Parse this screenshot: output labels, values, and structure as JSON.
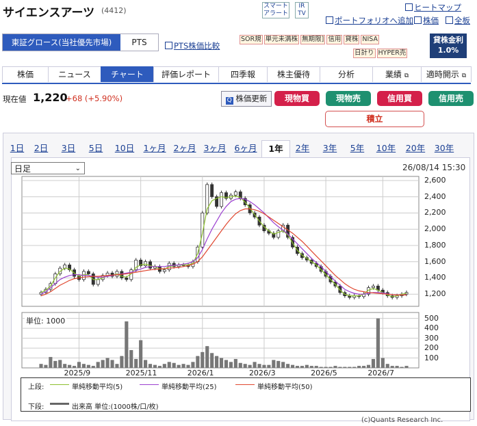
{
  "header": {
    "title": "サイエンスアーツ",
    "code": "(4412)",
    "smart_alert": "スマート\nアラート",
    "ir": "IR\nTV",
    "links": {
      "heatmap": "ヒートマップ",
      "add_portfolio": "ポートフォリオへ追加",
      "stock_price": "株価",
      "all_board": "全板",
      "pts_compare": "PTS株価比較"
    }
  },
  "market": {
    "selected": "東証グロース(当社優先市場)",
    "pts": "PTS"
  },
  "tags": [
    "SOR規",
    "単元未満株",
    "無期限]",
    "信用",
    "貸株",
    "NISA",
    "日計り",
    "HYPER売"
  ],
  "loan": {
    "label": "貸株金利",
    "rate": "1.0%"
  },
  "nav": {
    "tabs": [
      "株価",
      "ニュース",
      "チャート",
      "評価レポート",
      "四季報",
      "株主優待",
      "分析",
      "業績",
      "適時開示"
    ],
    "active": "チャート"
  },
  "quote": {
    "label": "現在値",
    "price": "1,220",
    "change": "+68 (+5.90%)"
  },
  "actions": {
    "update": "株価更新",
    "genbutsu_buy": "現物買",
    "genbutsu_sell": "現物売",
    "shinyo_buy": "信用買",
    "shinyo_sell": "信用売",
    "tsumitate": "積立"
  },
  "colors": {
    "brand": "#2e5bbd",
    "buy": "#d4204a",
    "sell": "#1e9070",
    "up": "#d03020"
  },
  "ranges": [
    "1日",
    "2日",
    "3日",
    "5日",
    "10日",
    "1ヶ月",
    "2ヶ月",
    "3ヶ月",
    "6ヶ月",
    "1年",
    "2年",
    "3年",
    "5年",
    "10年",
    "20年",
    "30年"
  ],
  "active_range": "1年",
  "chart_controls": {
    "period_select": "日足",
    "datetime": "26/08/14 15:30",
    "volume_unit": "単位: 1000"
  },
  "legend": {
    "upper_label": "上段:",
    "ma5": "単純移動平均(5)",
    "ma25": "単純移動平均(25)",
    "ma50": "単純移動平均(50)",
    "lower_label": "下段:",
    "volume": "出来高 単位:(1000株/口/枚)"
  },
  "copyright": "(c)Quants Research Inc.",
  "chart_data": {
    "type": "candlestick",
    "x_ticks": [
      "2025/9",
      "2025/11",
      "2026/1",
      "2026/3",
      "2026/5",
      "2026/7"
    ],
    "y_ticks": [
      "2,600",
      "2,400",
      "2,200",
      "2,000",
      "1,800",
      "1,600",
      "1,400",
      "1,200"
    ],
    "ylim": [
      1050,
      2650
    ],
    "volume_ticks": [
      "500",
      "400",
      "300",
      "200",
      "100"
    ],
    "volume_ylim": [
      0,
      560
    ],
    "close": [
      1220,
      1260,
      1330,
      1450,
      1520,
      1560,
      1500,
      1420,
      1380,
      1480,
      1450,
      1320,
      1380,
      1430,
      1460,
      1420,
      1480,
      1400,
      1380,
      1500,
      1620,
      1550,
      1600,
      1520,
      1540,
      1480,
      1500,
      1580,
      1540,
      1560,
      1560,
      1540,
      1600,
      1780,
      2200,
      2550,
      2400,
      2280,
      2450,
      2380,
      2420,
      2460,
      2380,
      2300,
      2200,
      2150,
      2050,
      1980,
      1950,
      1900,
      1980,
      2050,
      1900,
      1780,
      1700,
      1650,
      1620,
      1580,
      1540,
      1480,
      1420,
      1350,
      1300,
      1220,
      1180,
      1160,
      1180,
      1170,
      1200,
      1280,
      1300,
      1250,
      1220,
      1180,
      1160,
      1180,
      1200,
      1220
    ],
    "ma5": [
      1220,
      1250,
      1300,
      1400,
      1480,
      1520,
      1510,
      1460,
      1420,
      1440,
      1440,
      1380,
      1380,
      1400,
      1430,
      1430,
      1450,
      1420,
      1410,
      1450,
      1530,
      1560,
      1570,
      1550,
      1540,
      1510,
      1510,
      1540,
      1550,
      1560,
      1560,
      1560,
      1580,
      1700,
      1950,
      2250,
      2350,
      2380,
      2400,
      2390,
      2400,
      2410,
      2390,
      2330,
      2260,
      2180,
      2100,
      2030,
      1980,
      1940,
      1960,
      1980,
      1930,
      1830,
      1740,
      1680,
      1640,
      1600,
      1560,
      1500,
      1440,
      1380,
      1320,
      1250,
      1200,
      1180,
      1180,
      1180,
      1200,
      1250,
      1270,
      1250,
      1220,
      1190,
      1170,
      1180,
      1200,
      1210
    ],
    "ma25": [
      1200,
      1230,
      1280,
      1330,
      1380,
      1410,
      1430,
      1440,
      1440,
      1430,
      1430,
      1420,
      1410,
      1410,
      1420,
      1430,
      1440,
      1450,
      1460,
      1470,
      1490,
      1510,
      1530,
      1540,
      1540,
      1540,
      1540,
      1550,
      1555,
      1560,
      1570,
      1580,
      1600,
      1650,
      1750,
      1880,
      2000,
      2100,
      2200,
      2280,
      2340,
      2370,
      2380,
      2370,
      2340,
      2300,
      2250,
      2200,
      2140,
      2080,
      2030,
      1990,
      1940,
      1880,
      1820,
      1760,
      1700,
      1640,
      1590,
      1540,
      1480,
      1420,
      1360,
      1310,
      1260,
      1230,
      1210,
      1200,
      1200,
      1210,
      1220,
      1220,
      1215,
      1205,
      1195,
      1190,
      1190,
      1195
    ],
    "ma50": [
      1180,
      1200,
      1230,
      1270,
      1310,
      1340,
      1370,
      1390,
      1400,
      1410,
      1415,
      1420,
      1420,
      1425,
      1430,
      1435,
      1440,
      1445,
      1450,
      1460,
      1470,
      1480,
      1490,
      1500,
      1505,
      1510,
      1515,
      1520,
      1525,
      1530,
      1540,
      1550,
      1570,
      1600,
      1660,
      1740,
      1820,
      1900,
      1980,
      2060,
      2130,
      2190,
      2230,
      2250,
      2250,
      2240,
      2220,
      2190,
      2150,
      2110,
      2070,
      2030,
      1990,
      1950,
      1900,
      1850,
      1790,
      1730,
      1670,
      1610,
      1550,
      1490,
      1430,
      1380,
      1330,
      1290,
      1260,
      1240,
      1230,
      1220,
      1215,
      1210,
      1205,
      1200,
      1195,
      1190,
      1190,
      1190
    ],
    "volume": [
      40,
      30,
      110,
      70,
      80,
      40,
      30,
      20,
      60,
      40,
      30,
      20,
      60,
      80,
      100,
      80,
      40,
      120,
      470,
      180,
      90,
      280,
      80,
      40,
      30,
      20,
      40,
      60,
      50,
      30,
      40,
      30,
      60,
      120,
      160,
      220,
      150,
      120,
      100,
      80,
      60,
      90,
      50,
      40,
      30,
      60,
      40,
      30,
      30,
      80,
      70,
      60,
      40,
      30,
      20,
      20,
      30,
      20,
      20,
      10,
      10,
      10,
      20,
      10,
      10,
      10,
      10,
      20,
      20,
      30,
      90,
      500,
      100,
      40,
      20,
      20,
      10,
      20
    ],
    "series": [
      {
        "name": "単純移動平均(5)",
        "color": "#8cbf2e"
      },
      {
        "name": "単純移動平均(25)",
        "color": "#9b40d0"
      },
      {
        "name": "単純移動平均(50)",
        "color": "#e0472f"
      }
    ]
  }
}
